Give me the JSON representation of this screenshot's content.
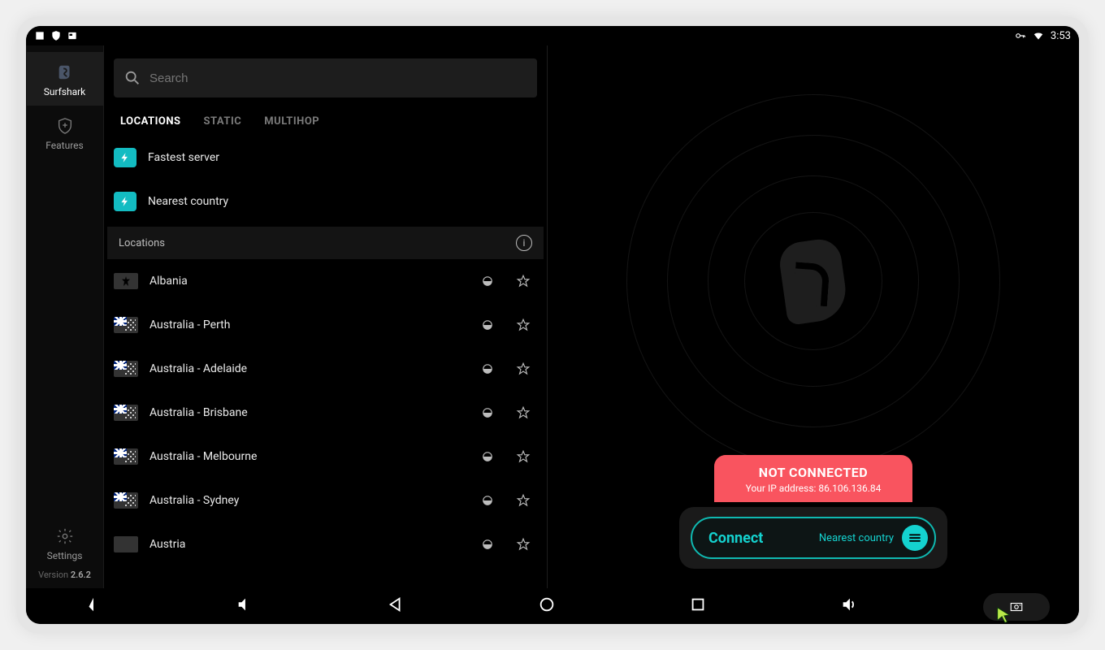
{
  "statusbar": {
    "time": "3:53"
  },
  "rail": {
    "app_label": "Surfshark",
    "features_label": "Features",
    "settings_label": "Settings",
    "version_prefix": "Version ",
    "version": "2.6.2"
  },
  "search": {
    "placeholder": "Search"
  },
  "tabs": {
    "locations": "LOCATIONS",
    "static": "STATIC",
    "multihop": "MULTIHOP"
  },
  "quick": {
    "fastest": "Fastest server",
    "nearest": "Nearest country"
  },
  "section_header": "Locations",
  "locations": [
    {
      "name": "Albania",
      "flag": "al"
    },
    {
      "name": "Australia - Perth",
      "flag": "au"
    },
    {
      "name": "Australia - Adelaide",
      "flag": "au"
    },
    {
      "name": "Australia - Brisbane",
      "flag": "au"
    },
    {
      "name": "Australia - Melbourne",
      "flag": "au"
    },
    {
      "name": "Australia - Sydney",
      "flag": "au"
    },
    {
      "name": "Austria",
      "flag": "at"
    }
  ],
  "status": {
    "title": "NOT CONNECTED",
    "ip_prefix": "Your IP address: ",
    "ip": "86.106.136.84"
  },
  "connect": {
    "label": "Connect",
    "selection": "Nearest country"
  }
}
